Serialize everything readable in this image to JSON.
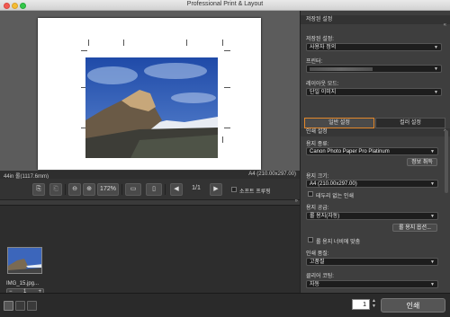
{
  "window": {
    "title": "Professional Print & Layout"
  },
  "preview": {
    "size_left": "44in 롤(1117.6mm)",
    "size_right": "A4 (210.00x297.00)"
  },
  "toolbar": {
    "zoom": "172%",
    "page_counter": "1/1",
    "soft_proof_label": "소프트 프루핑"
  },
  "filmstrip": {
    "thumb_name": "IMG_15.jpg...",
    "copies": "1"
  },
  "panel": {
    "saved_section_title": "저장된 설정",
    "saved_settings_label": "저장된 설정:",
    "saved_settings_value": "사용자 정의",
    "printer_label": "프린터:",
    "printer_value": "",
    "layout_mode_label": "레이아웃 모드:",
    "layout_mode_value": "단일 이미지",
    "tab_general": "일반 설정",
    "tab_color": "컬러 설정",
    "print_settings_title": "인쇄 설정",
    "paper_type_label": "용지 종류:",
    "paper_type_value": "Canon Photo Paper Pro Platinum",
    "info_cancel_button": "정보 취득",
    "paper_size_label": "용지 크기:",
    "paper_size_value": "A4 (210.00x297.00)",
    "borderless_label": "테두리 없는 인쇄",
    "paper_source_label": "용지 공급:",
    "paper_source_value": "롤 용지(자동)",
    "roll_options_button": "롤 용지 옵션...",
    "fit_roll_width_label": "롤 용지 너비에 맞춤",
    "print_quality_label": "인쇄 품질:",
    "print_quality_value": "고품질",
    "clear_coating_label": "클리어 코팅:",
    "clear_coating_value": "자동"
  },
  "bottom": {
    "copies": "1",
    "print_button": "인쇄"
  },
  "colors": {
    "accent": "#e3882b",
    "panel_bg": "#3e3e3e",
    "canvas_bg": "#5c5c5c"
  }
}
